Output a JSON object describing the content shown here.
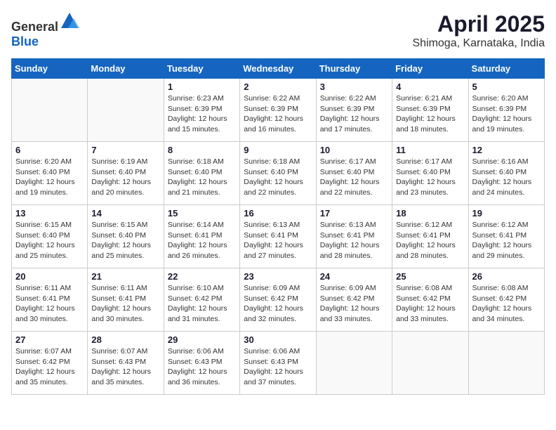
{
  "header": {
    "logo_general": "General",
    "logo_blue": "Blue",
    "title": "April 2025",
    "location": "Shimoga, Karnataka, India"
  },
  "calendar": {
    "weekdays": [
      "Sunday",
      "Monday",
      "Tuesday",
      "Wednesday",
      "Thursday",
      "Friday",
      "Saturday"
    ],
    "weeks": [
      [
        {
          "day": "",
          "sunrise": "",
          "sunset": "",
          "daylight": ""
        },
        {
          "day": "",
          "sunrise": "",
          "sunset": "",
          "daylight": ""
        },
        {
          "day": "1",
          "sunrise": "Sunrise: 6:23 AM",
          "sunset": "Sunset: 6:39 PM",
          "daylight": "Daylight: 12 hours and 15 minutes."
        },
        {
          "day": "2",
          "sunrise": "Sunrise: 6:22 AM",
          "sunset": "Sunset: 6:39 PM",
          "daylight": "Daylight: 12 hours and 16 minutes."
        },
        {
          "day": "3",
          "sunrise": "Sunrise: 6:22 AM",
          "sunset": "Sunset: 6:39 PM",
          "daylight": "Daylight: 12 hours and 17 minutes."
        },
        {
          "day": "4",
          "sunrise": "Sunrise: 6:21 AM",
          "sunset": "Sunset: 6:39 PM",
          "daylight": "Daylight: 12 hours and 18 minutes."
        },
        {
          "day": "5",
          "sunrise": "Sunrise: 6:20 AM",
          "sunset": "Sunset: 6:39 PM",
          "daylight": "Daylight: 12 hours and 19 minutes."
        }
      ],
      [
        {
          "day": "6",
          "sunrise": "Sunrise: 6:20 AM",
          "sunset": "Sunset: 6:40 PM",
          "daylight": "Daylight: 12 hours and 19 minutes."
        },
        {
          "day": "7",
          "sunrise": "Sunrise: 6:19 AM",
          "sunset": "Sunset: 6:40 PM",
          "daylight": "Daylight: 12 hours and 20 minutes."
        },
        {
          "day": "8",
          "sunrise": "Sunrise: 6:18 AM",
          "sunset": "Sunset: 6:40 PM",
          "daylight": "Daylight: 12 hours and 21 minutes."
        },
        {
          "day": "9",
          "sunrise": "Sunrise: 6:18 AM",
          "sunset": "Sunset: 6:40 PM",
          "daylight": "Daylight: 12 hours and 22 minutes."
        },
        {
          "day": "10",
          "sunrise": "Sunrise: 6:17 AM",
          "sunset": "Sunset: 6:40 PM",
          "daylight": "Daylight: 12 hours and 22 minutes."
        },
        {
          "day": "11",
          "sunrise": "Sunrise: 6:17 AM",
          "sunset": "Sunset: 6:40 PM",
          "daylight": "Daylight: 12 hours and 23 minutes."
        },
        {
          "day": "12",
          "sunrise": "Sunrise: 6:16 AM",
          "sunset": "Sunset: 6:40 PM",
          "daylight": "Daylight: 12 hours and 24 minutes."
        }
      ],
      [
        {
          "day": "13",
          "sunrise": "Sunrise: 6:15 AM",
          "sunset": "Sunset: 6:40 PM",
          "daylight": "Daylight: 12 hours and 25 minutes."
        },
        {
          "day": "14",
          "sunrise": "Sunrise: 6:15 AM",
          "sunset": "Sunset: 6:40 PM",
          "daylight": "Daylight: 12 hours and 25 minutes."
        },
        {
          "day": "15",
          "sunrise": "Sunrise: 6:14 AM",
          "sunset": "Sunset: 6:41 PM",
          "daylight": "Daylight: 12 hours and 26 minutes."
        },
        {
          "day": "16",
          "sunrise": "Sunrise: 6:13 AM",
          "sunset": "Sunset: 6:41 PM",
          "daylight": "Daylight: 12 hours and 27 minutes."
        },
        {
          "day": "17",
          "sunrise": "Sunrise: 6:13 AM",
          "sunset": "Sunset: 6:41 PM",
          "daylight": "Daylight: 12 hours and 28 minutes."
        },
        {
          "day": "18",
          "sunrise": "Sunrise: 6:12 AM",
          "sunset": "Sunset: 6:41 PM",
          "daylight": "Daylight: 12 hours and 28 minutes."
        },
        {
          "day": "19",
          "sunrise": "Sunrise: 6:12 AM",
          "sunset": "Sunset: 6:41 PM",
          "daylight": "Daylight: 12 hours and 29 minutes."
        }
      ],
      [
        {
          "day": "20",
          "sunrise": "Sunrise: 6:11 AM",
          "sunset": "Sunset: 6:41 PM",
          "daylight": "Daylight: 12 hours and 30 minutes."
        },
        {
          "day": "21",
          "sunrise": "Sunrise: 6:11 AM",
          "sunset": "Sunset: 6:41 PM",
          "daylight": "Daylight: 12 hours and 30 minutes."
        },
        {
          "day": "22",
          "sunrise": "Sunrise: 6:10 AM",
          "sunset": "Sunset: 6:42 PM",
          "daylight": "Daylight: 12 hours and 31 minutes."
        },
        {
          "day": "23",
          "sunrise": "Sunrise: 6:09 AM",
          "sunset": "Sunset: 6:42 PM",
          "daylight": "Daylight: 12 hours and 32 minutes."
        },
        {
          "day": "24",
          "sunrise": "Sunrise: 6:09 AM",
          "sunset": "Sunset: 6:42 PM",
          "daylight": "Daylight: 12 hours and 33 minutes."
        },
        {
          "day": "25",
          "sunrise": "Sunrise: 6:08 AM",
          "sunset": "Sunset: 6:42 PM",
          "daylight": "Daylight: 12 hours and 33 minutes."
        },
        {
          "day": "26",
          "sunrise": "Sunrise: 6:08 AM",
          "sunset": "Sunset: 6:42 PM",
          "daylight": "Daylight: 12 hours and 34 minutes."
        }
      ],
      [
        {
          "day": "27",
          "sunrise": "Sunrise: 6:07 AM",
          "sunset": "Sunset: 6:42 PM",
          "daylight": "Daylight: 12 hours and 35 minutes."
        },
        {
          "day": "28",
          "sunrise": "Sunrise: 6:07 AM",
          "sunset": "Sunset: 6:43 PM",
          "daylight": "Daylight: 12 hours and 35 minutes."
        },
        {
          "day": "29",
          "sunrise": "Sunrise: 6:06 AM",
          "sunset": "Sunset: 6:43 PM",
          "daylight": "Daylight: 12 hours and 36 minutes."
        },
        {
          "day": "30",
          "sunrise": "Sunrise: 6:06 AM",
          "sunset": "Sunset: 6:43 PM",
          "daylight": "Daylight: 12 hours and 37 minutes."
        },
        {
          "day": "",
          "sunrise": "",
          "sunset": "",
          "daylight": ""
        },
        {
          "day": "",
          "sunrise": "",
          "sunset": "",
          "daylight": ""
        },
        {
          "day": "",
          "sunrise": "",
          "sunset": "",
          "daylight": ""
        }
      ]
    ]
  }
}
